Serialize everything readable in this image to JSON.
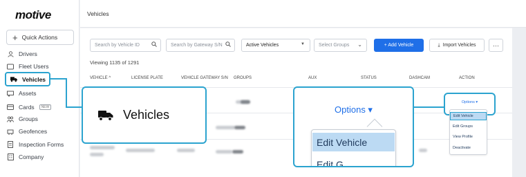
{
  "app": {
    "logo": "motive"
  },
  "sidebar": {
    "quick_actions": "Quick Actions",
    "items": [
      {
        "label": "Drivers",
        "icon": "person-icon"
      },
      {
        "label": "Fleet Users",
        "icon": "users-icon"
      },
      {
        "label": "Vehicles",
        "icon": "truck-icon",
        "active": true
      },
      {
        "label": "Assets",
        "icon": "trailer-icon"
      },
      {
        "label": "Cards",
        "icon": "card-icon",
        "badge": "NEW"
      },
      {
        "label": "Groups",
        "icon": "groups-icon"
      },
      {
        "label": "Geofences",
        "icon": "geofence-icon"
      },
      {
        "label": "Inspection Forms",
        "icon": "form-icon"
      },
      {
        "label": "Company",
        "icon": "building-icon"
      }
    ]
  },
  "header": {
    "title": "Vehicles"
  },
  "toolbar": {
    "search_vehicle_placeholder": "Search by Vehicle ID",
    "search_gateway_placeholder": "Search by Gateway S/N",
    "status_filter": "Active Vehicles",
    "groups_placeholder": "Select Groups",
    "add_vehicle": "+ Add Vehicle",
    "import_vehicles": "Import Vehicles",
    "more": "···"
  },
  "table": {
    "viewing": "Viewing 1135 of 1291",
    "columns": [
      "VEHICLE ^",
      "LICENSE PLATE",
      "VEHICLE GATEWAY S/N",
      "GROUPS",
      "AUX",
      "STATUS",
      "DASHCAM",
      "ACTION"
    ]
  },
  "callouts": {
    "vehicles_label": "Vehicles",
    "options_label": "Options ▾",
    "menu_active": "Edit Vehicle",
    "menu_next": "Edit G"
  },
  "mini_menu": {
    "title": "Options ▾",
    "items": [
      "Edit Vehicle",
      "Edit Groups",
      "View Profile",
      "Deactivate"
    ]
  },
  "colors": {
    "accent": "#2ba3cf",
    "primary": "#1f6fe8",
    "highlight": "#bcdaf3"
  }
}
